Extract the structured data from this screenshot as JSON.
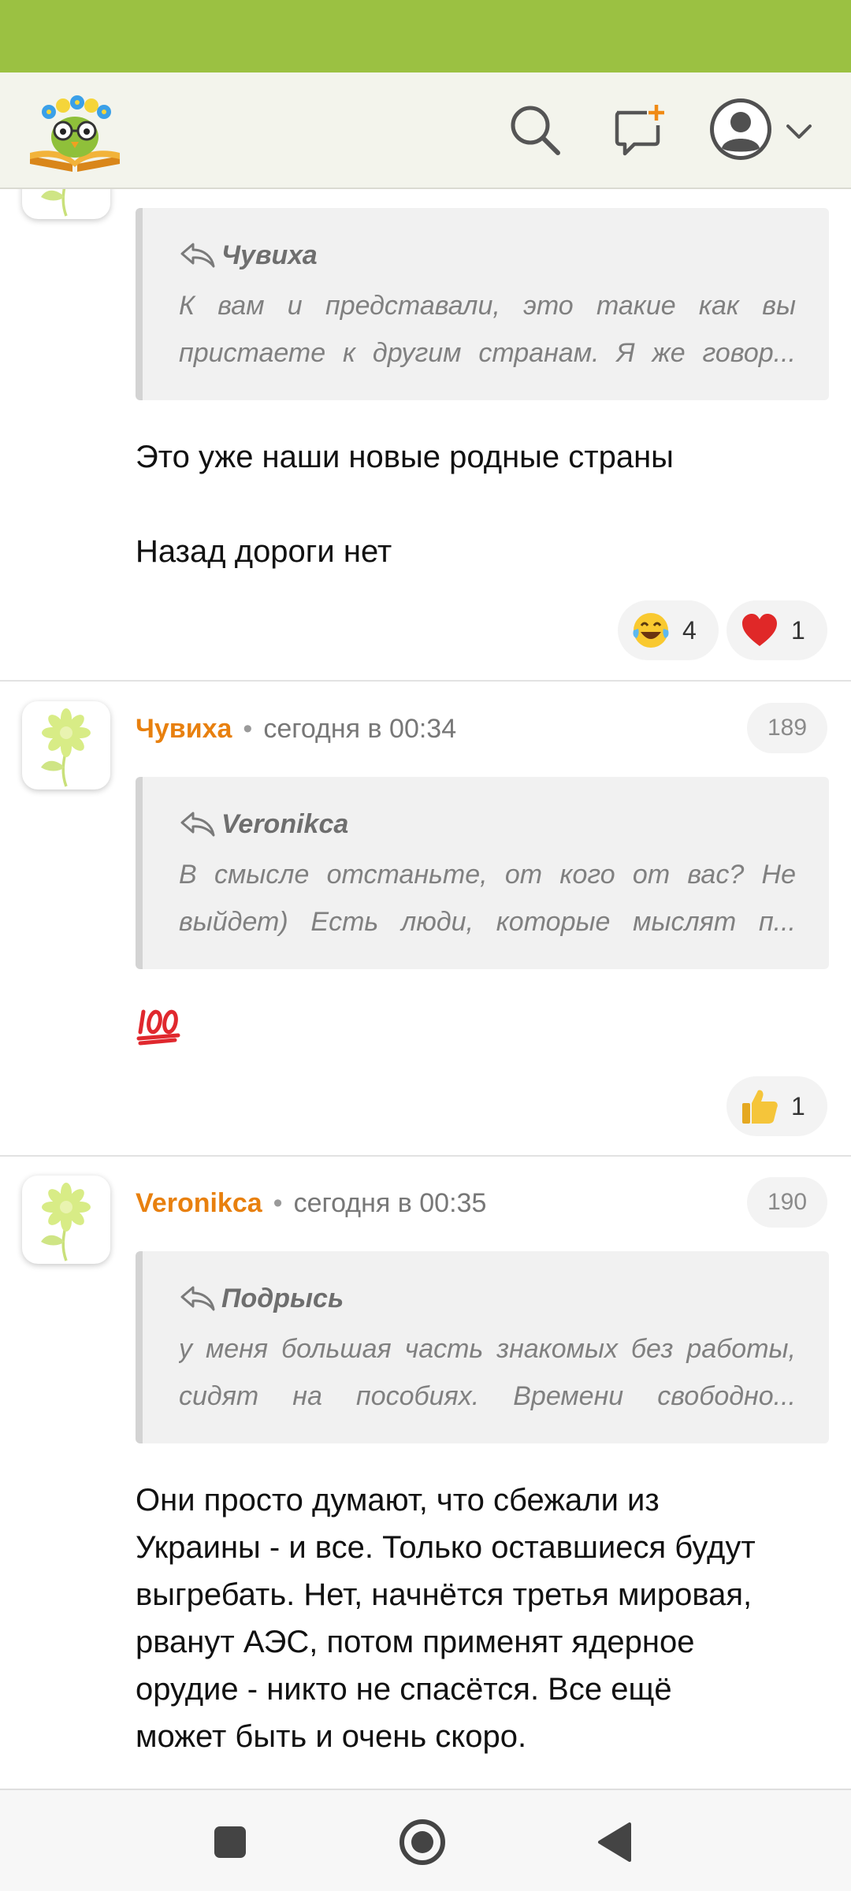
{
  "header": {
    "logo_icon": "owl-on-book-logo-icon",
    "search_icon": "search-icon",
    "new_post_icon": "new-message-plus-icon",
    "profile_icon": "user-avatar-icon",
    "dropdown_icon": "chevron-down-icon"
  },
  "colors": {
    "status_bar": "#9bc142",
    "header_bg": "#f3f4ec",
    "author_name": "#e8800e",
    "quote_bg": "#f1f1f1"
  },
  "comments": [
    {
      "quote_author": "Чувиха",
      "quote_lines": [
        "К вам и представали, это такие как вы",
        "пристаете к другим странам. Я же говор..."
      ],
      "text_lines": [
        "Это уже наши новые родные страны",
        "",
        "Назад дороги нет"
      ],
      "reactions": [
        {
          "icon": "laughing-tears-emoji-icon",
          "count": "4"
        },
        {
          "icon": "red-heart-emoji-icon",
          "count": "1"
        }
      ]
    },
    {
      "author": "Чувиха",
      "separator": "•",
      "time": "сегодня в 00:34",
      "number": "189",
      "quote_author": "Veronikca",
      "quote_lines": [
        "В смысле отстаньте, от кого от вас? Не",
        "выйдет) Есть люди, которые мыслят п..."
      ],
      "text_icon": "hundred-points-emoji-icon",
      "reactions": [
        {
          "icon": "thumbs-up-emoji-icon",
          "count": "1"
        }
      ]
    },
    {
      "author": "Veronikca",
      "separator": "•",
      "time": "сегодня в 00:35",
      "number": "190",
      "quote_author": "Подрысь",
      "quote_lines": [
        "у меня большая часть знакомых без работы,",
        "сидят на пособиях. Времени свободно..."
      ],
      "text_lines": [
        "Они просто думают, что сбежали из",
        "Украины - и все. Только оставшиеся будут",
        "выгребать. Нет, начнётся третья мировая,",
        "рванут АЭС, потом применят ядерное",
        "орудие - никто не спасётся. Все ещё",
        "может быть и очень скоро."
      ]
    }
  ],
  "navbar": {
    "recents_icon": "square-recents-icon",
    "home_icon": "circle-home-icon",
    "back_icon": "triangle-back-icon"
  }
}
